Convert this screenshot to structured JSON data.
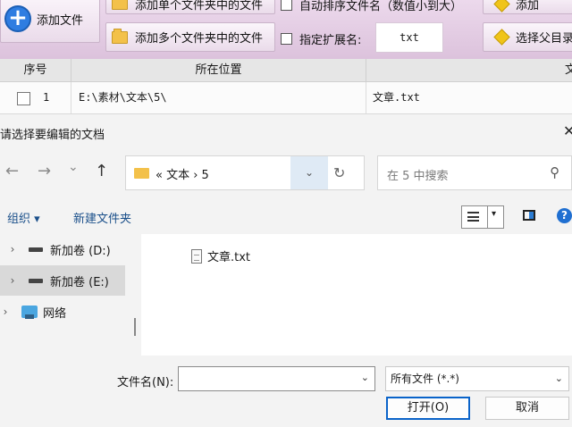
{
  "toolbar": {
    "add_file": "添加文件",
    "add_single_folder": "添加单个文件夹中的文件",
    "add_multi_folder": "添加多个文件夹中的文件",
    "auto_sort": "自动排序文件名（数值小到大）",
    "specify_ext_label": "指定扩展名:",
    "ext_value": "txt",
    "add_right": "添加",
    "select_parent": "选择父目录"
  },
  "table": {
    "headers": [
      "序号",
      "所在位置"
    ],
    "header_right_glyph": "文",
    "rows": [
      {
        "index": "1",
        "location": "E:\\素材\\文本\\5\\",
        "name": "文章.txt"
      }
    ]
  },
  "dialog": {
    "title": "请选择要编辑的文档",
    "close_glyph": "✕",
    "back_glyph": "←",
    "forward_glyph": "→",
    "history_glyph": "⌄",
    "up_glyph": "↑",
    "address_text": "«  文本  ›  5",
    "address_dropdown_glyph": "⌄",
    "refresh_glyph": "↻",
    "search_placeholder": "在 5 中搜索",
    "search_glyph": "⚲",
    "organize": "组织 ▾",
    "new_folder": "新建文件夹",
    "view_caret": "▾",
    "help_glyph": "?",
    "tree": [
      {
        "chevron": "›",
        "label": "新加卷 (D:)"
      },
      {
        "chevron": "›",
        "label": "新加卷 (E:)"
      },
      {
        "chevron": "›",
        "label": "网络"
      }
    ],
    "files": [
      "文章.txt"
    ],
    "filename_label": "文件名(N):",
    "filename_value": "",
    "filename_caret": "⌄",
    "filter_value": "所有文件 (*.*)",
    "filter_caret": "⌄",
    "open_button": "打开(O)",
    "cancel_button": "取消"
  },
  "colors": {
    "toolbar_bg": "#dcc2dc",
    "accent": "#0a63c9",
    "link": "#1a4f8a"
  }
}
